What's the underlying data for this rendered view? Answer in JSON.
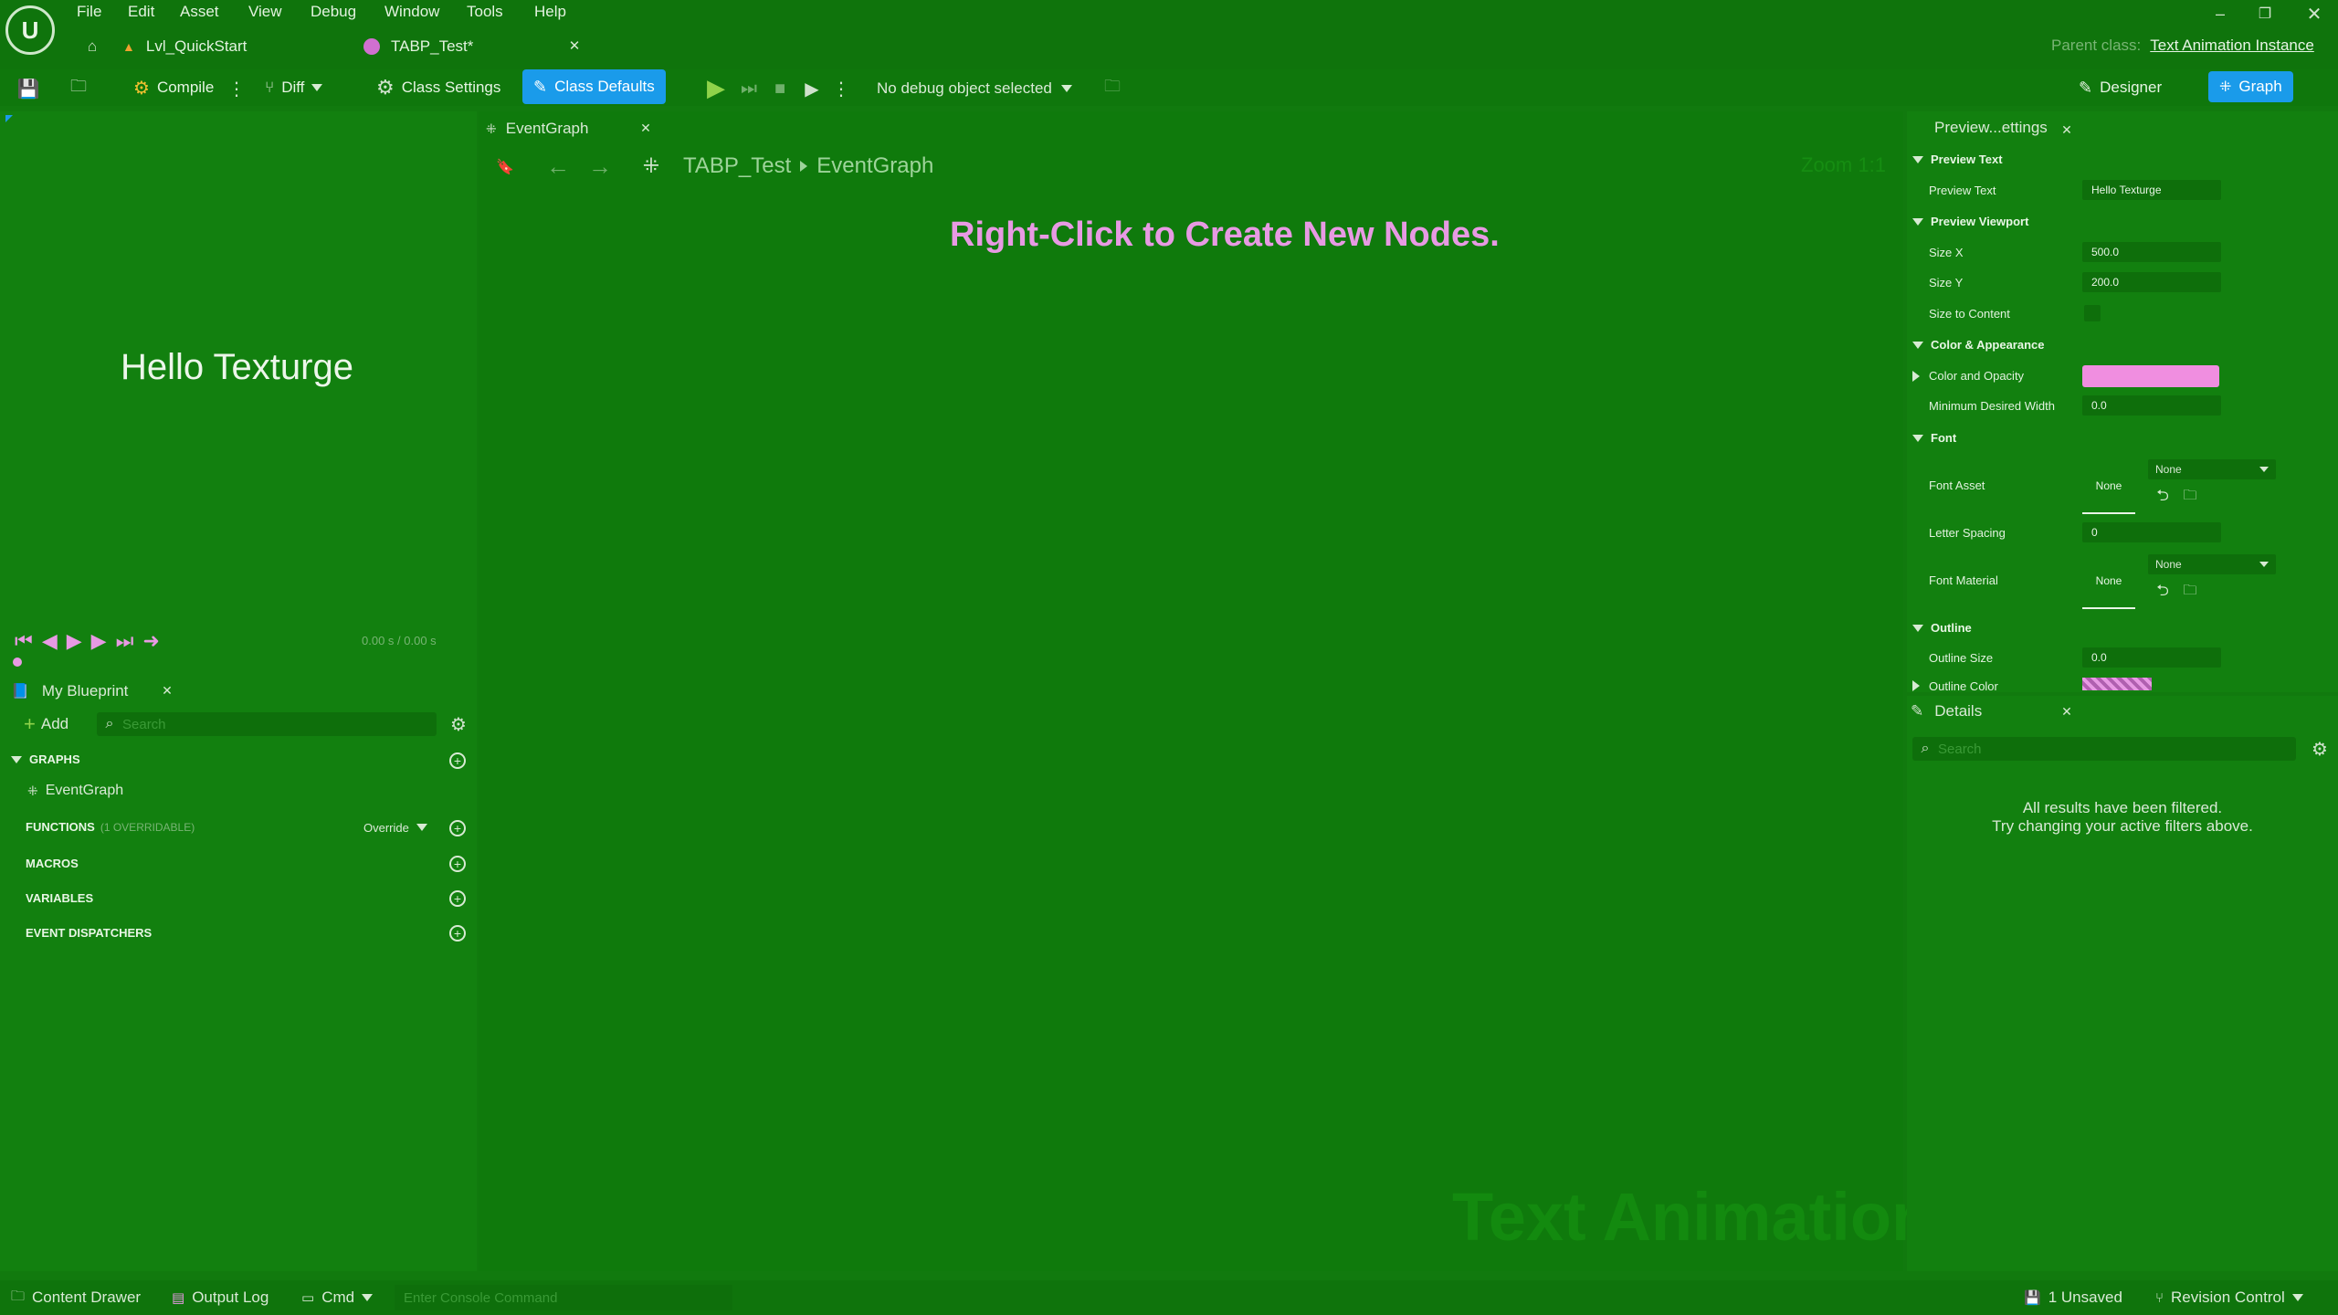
{
  "menu": [
    "File",
    "Edit",
    "Asset",
    "View",
    "Debug",
    "Window",
    "Tools",
    "Help"
  ],
  "tabs": [
    {
      "label": "Lvl_QuickStart"
    },
    {
      "label": "TABP_Test*"
    }
  ],
  "parent_class": {
    "label": "Parent class:",
    "value": "Text Animation Instance"
  },
  "toolbar": {
    "compile": "Compile",
    "diff": "Diff",
    "class_settings": "Class Settings",
    "class_defaults": "Class Defaults",
    "debug_select": "No debug object selected",
    "designer": "Designer",
    "graph": "Graph"
  },
  "preview": {
    "text": "Hello Texturge",
    "time": "0.00 s / 0.00 s"
  },
  "my_blueprint": {
    "title": "My Blueprint",
    "add": "Add",
    "search_placeholder": "Search",
    "sections": {
      "graphs": "GRAPHS",
      "event_graph": "EventGraph",
      "functions": "FUNCTIONS",
      "functions_note": "(1 OVERRIDABLE)",
      "override": "Override",
      "macros": "MACROS",
      "variables": "VARIABLES",
      "event_dispatchers": "EVENT DISPATCHERS"
    }
  },
  "graph": {
    "tab": "EventGraph",
    "breadcrumb_root": "TABP_Test",
    "breadcrumb_leaf": "EventGraph",
    "zoom": "Zoom 1:1",
    "hint": "Right-Click to Create New Nodes.",
    "watermark": "Text Animation"
  },
  "preview_settings": {
    "title": "Preview...ettings",
    "sections": {
      "preview_text": "Preview Text",
      "preview_viewport": "Preview Viewport",
      "color_appearance": "Color & Appearance",
      "font": "Font",
      "outline": "Outline"
    },
    "props": {
      "preview_text_label": "Preview Text",
      "preview_text_value": "Hello Texturge",
      "size_x_label": "Size X",
      "size_x_value": "500.0",
      "size_y_label": "Size Y",
      "size_y_value": "200.0",
      "size_to_content_label": "Size to Content",
      "color_opacity_label": "Color and Opacity",
      "min_width_label": "Minimum Desired Width",
      "min_width_value": "0.0",
      "font_asset_label": "Font Asset",
      "font_asset_thumb": "None",
      "font_asset_select": "None",
      "letter_spacing_label": "Letter Spacing",
      "letter_spacing_value": "0",
      "font_material_label": "Font Material",
      "font_material_thumb": "None",
      "font_material_select": "None",
      "outline_size_label": "Outline Size",
      "outline_size_value": "0.0",
      "outline_color_label": "Outline Color"
    },
    "color_swatch": "#f08ee0"
  },
  "details": {
    "title": "Details",
    "search_placeholder": "Search",
    "msg1": "All results have been filtered.",
    "msg2": "Try changing your active filters above."
  },
  "statusbar": {
    "content_drawer": "Content Drawer",
    "output_log": "Output Log",
    "cmd": "Cmd",
    "console_placeholder": "Enter Console Command",
    "unsaved": "1 Unsaved",
    "revision": "Revision Control"
  },
  "colors": {
    "accent": "#1a9bea",
    "highlight_text": "#e79ae3",
    "play_green": "#8fd34a"
  }
}
